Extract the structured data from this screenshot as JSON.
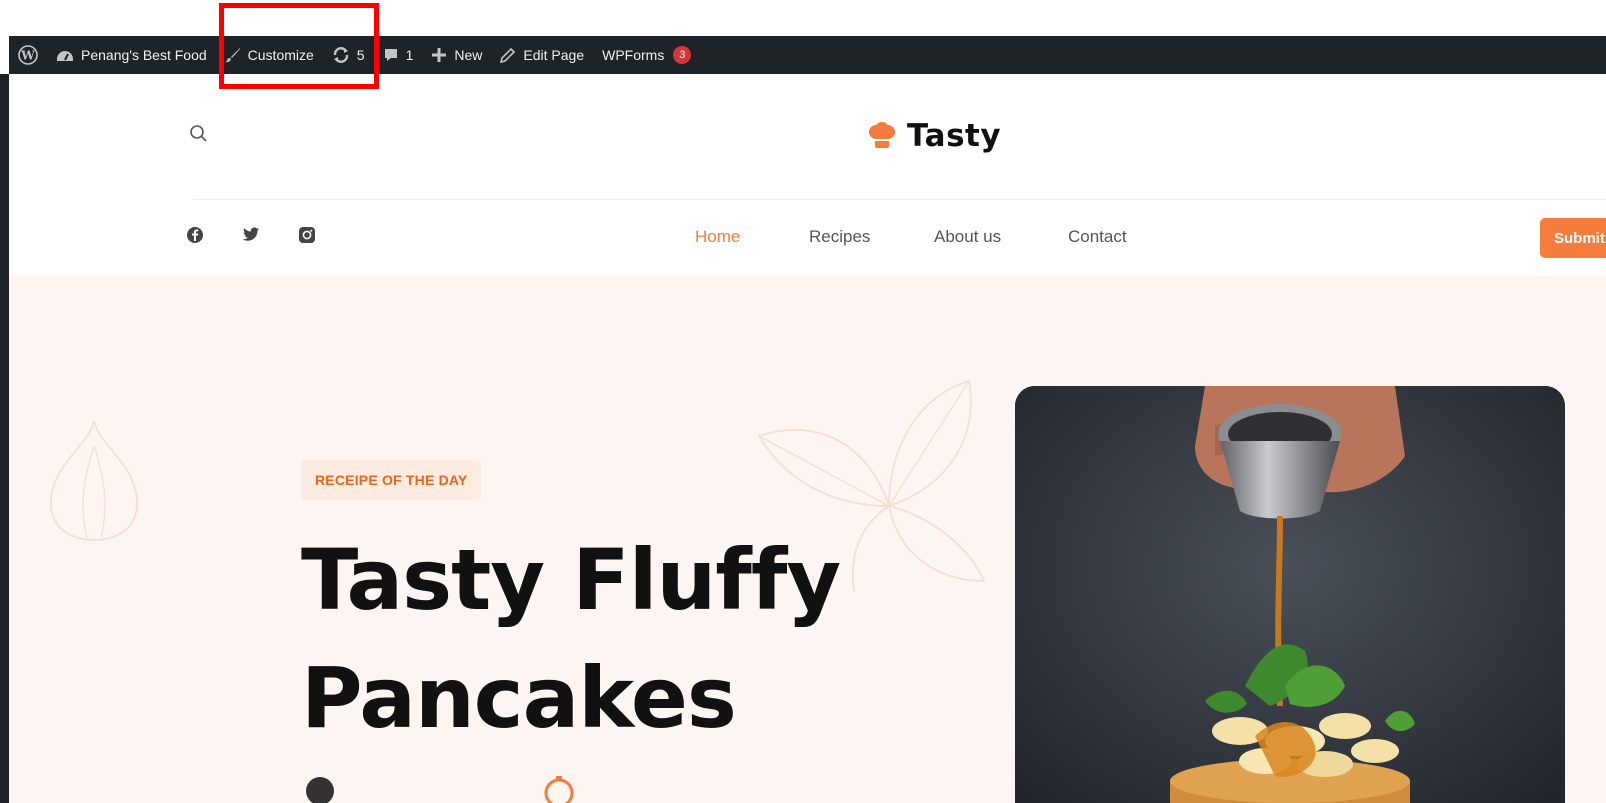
{
  "admin_bar": {
    "site_name": "Penang's Best Food",
    "customize": "Customize",
    "updates_count": "5",
    "comments_count": "1",
    "new_label": "New",
    "edit_page": "Edit Page",
    "wpforms": "WPForms",
    "wpforms_badge": "3"
  },
  "header": {
    "logo_text": "Tasty",
    "nav": [
      "Home",
      "Recipes",
      "About us",
      "Contact"
    ],
    "active_nav": "Home",
    "submit_label": "Submit"
  },
  "hero": {
    "tag": "RECEIPE OF THE DAY",
    "title_line1": "Tasty Fluffy",
    "title_line2": "Pancakes"
  },
  "colors": {
    "accent": "#f47c3c",
    "admin_bar": "#1d2327",
    "hero_bg": "#fdf5f1",
    "highlight": "#ff0000"
  }
}
